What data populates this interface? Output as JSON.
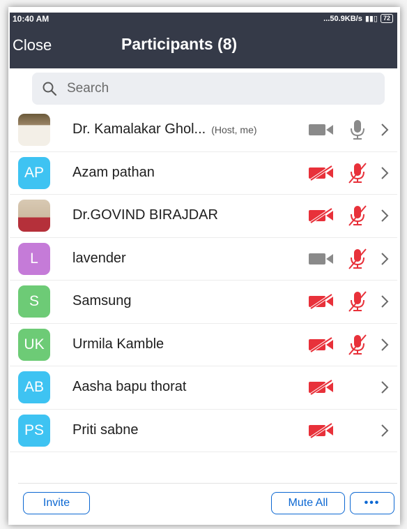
{
  "status_bar": {
    "time": "10:40 AM",
    "network_speed": "...50.9KB/s",
    "battery": "72"
  },
  "header": {
    "close_label": "Close",
    "title": "Participants (8)"
  },
  "search": {
    "placeholder": "Search",
    "value": ""
  },
  "participants": [
    {
      "name": "Dr. Kamalakar Ghol...",
      "role": "(Host, me)",
      "initials": "",
      "avatar_color": "",
      "photo": true,
      "video_off": false,
      "mic": "on"
    },
    {
      "name": "Azam pathan",
      "role": "",
      "initials": "AP",
      "avatar_color": "#3ec3f2",
      "photo": false,
      "video_off": true,
      "mic": "muted"
    },
    {
      "name": "Dr.GOVIND BIRAJDAR",
      "role": "",
      "initials": "",
      "avatar_color": "",
      "photo": true,
      "video_off": true,
      "mic": "muted"
    },
    {
      "name": "lavender",
      "role": "",
      "initials": "L",
      "avatar_color": "#c57bd8",
      "photo": false,
      "video_off": false,
      "mic": "muted"
    },
    {
      "name": "Samsung",
      "role": "",
      "initials": "S",
      "avatar_color": "#6dcb76",
      "photo": false,
      "video_off": true,
      "mic": "muted"
    },
    {
      "name": "Urmila Kamble",
      "role": "",
      "initials": "UK",
      "avatar_color": "#6dcb76",
      "photo": false,
      "video_off": true,
      "mic": "muted"
    },
    {
      "name": "Aasha bapu thorat",
      "role": "",
      "initials": "AB",
      "avatar_color": "#3ec3f2",
      "photo": false,
      "video_off": true,
      "mic": "none"
    },
    {
      "name": "Priti sabne",
      "role": "",
      "initials": "PS",
      "avatar_color": "#3ec3f2",
      "photo": false,
      "video_off": true,
      "mic": "none"
    }
  ],
  "footer": {
    "invite_label": "Invite",
    "mute_all_label": "Mute All",
    "more_label": "•••"
  },
  "colors": {
    "header_bg": "#353a48",
    "accent_blue": "#0b67d2",
    "muted_red": "#e8313a",
    "icon_gray": "#8a8a8a"
  }
}
